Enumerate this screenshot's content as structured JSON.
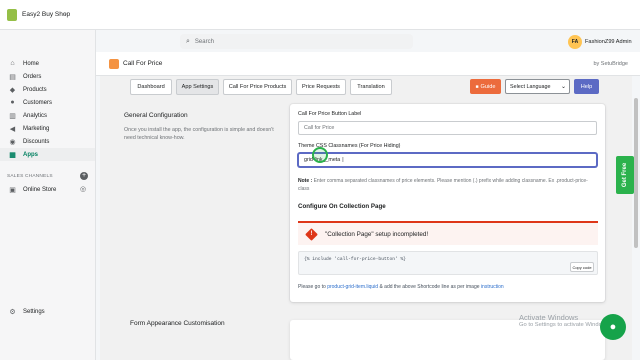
{
  "topbar": {
    "shop_name": "Easy2 Buy Shop",
    "search_placeholder": "Search",
    "avatar_initials": "FA",
    "user_name": "FashionZ99 Admin"
  },
  "sidebar": {
    "items": [
      {
        "label": "Home",
        "icon": "home-icon"
      },
      {
        "label": "Orders",
        "icon": "orders-icon"
      },
      {
        "label": "Products",
        "icon": "tag-icon"
      },
      {
        "label": "Customers",
        "icon": "person-icon"
      },
      {
        "label": "Analytics",
        "icon": "chart-icon"
      },
      {
        "label": "Marketing",
        "icon": "megaphone-icon"
      },
      {
        "label": "Discounts",
        "icon": "discount-icon"
      },
      {
        "label": "Apps",
        "icon": "apps-icon",
        "active": true
      }
    ],
    "channels_label": "SALES CHANNELS",
    "online_store": "Online Store",
    "settings": "Settings"
  },
  "app_header": {
    "title": "Call For Price",
    "by": "by SetuBridge"
  },
  "tabs": [
    "Dashboard",
    "App Settings",
    "Call For Price Products",
    "Price Requests",
    "Translation"
  ],
  "active_tab": "App Settings",
  "toolbar": {
    "guide": "Guide",
    "language": "Select Language",
    "help": "Help"
  },
  "general": {
    "title": "General Configuration",
    "description": "Once you install the app, the configuration is simple and doesn't need technical know-how.",
    "button_label_title": "Call For Price Button Label",
    "button_label_value": "Call for Price",
    "classnames_title": "Theme CSS Classnames (For Price Hiding)",
    "classnames_value": "grid-link__meta",
    "note_label": "Note :",
    "note_text": "Enter comma separated classnames of price elements. Please mention (.) prefix while adding classname. Ex .product-price-class",
    "collection_title": "Configure On Collection Page",
    "alert_text": "\"Collection Page\" setup incompleted!",
    "code": "{% include 'call-for-price-button' %}",
    "copy_label": "Copy code",
    "instr_pre": "Please go to",
    "instr_link": "product-grid-item.liquid",
    "instr_mid": "& add the above Shortcode line as per image",
    "instr_link2": "instruction"
  },
  "form_section": {
    "title": "Form Appearance Customisation"
  },
  "feedback": "Get Free",
  "watermark": {
    "line1": "Activate Windows",
    "line2": "Go to Settings to activate Windows."
  },
  "colors": {
    "primary": "#5c6ac4",
    "guide": "#ec6b3c",
    "critical": "#de3618",
    "active_nav": "#008060",
    "feedback": "#2bb24c"
  }
}
